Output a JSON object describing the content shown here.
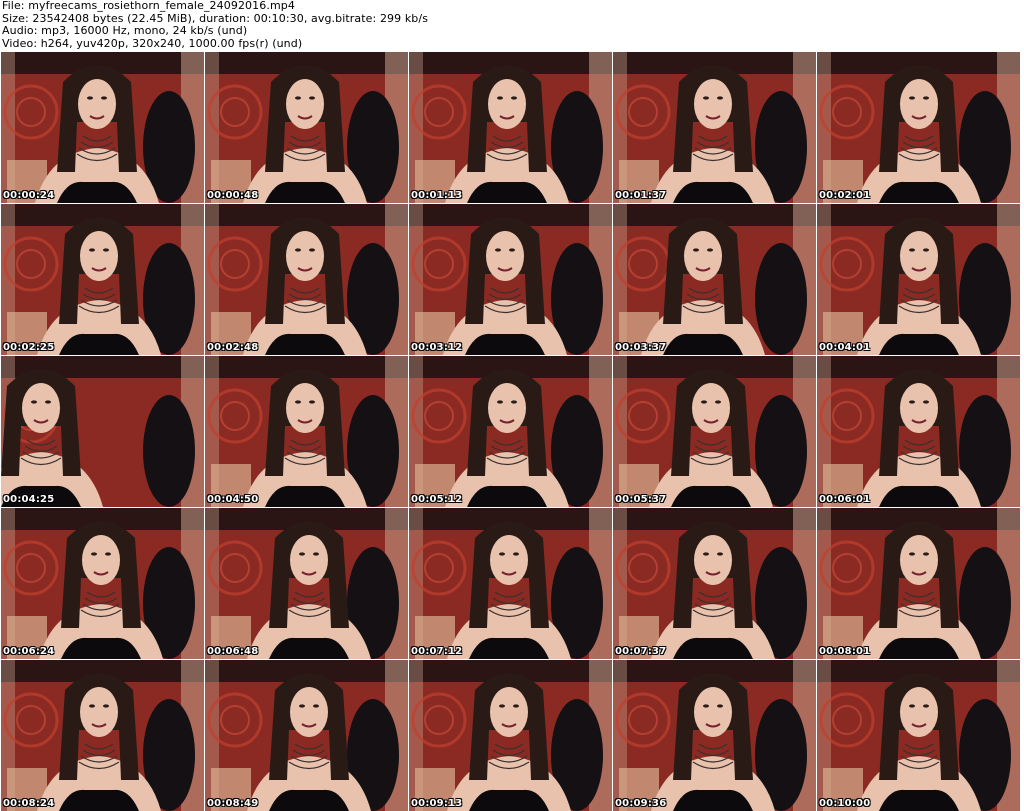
{
  "header": {
    "file": "File: myfreecams_rosiethorn_female_24092016.mp4",
    "size": "Size: 23542408 bytes (22.45 MiB), duration: 00:10:30, avg.bitrate: 299 kb/s",
    "audio": "Audio: mp3, 16000 Hz, mono, 24 kb/s (und)",
    "video": "Video: h264, yuv420p, 320x240, 1000.00 fps(r) (und)"
  },
  "thumbnails": [
    {
      "time": "00:00:24"
    },
    {
      "time": "00:00:48"
    },
    {
      "time": "00:01:13"
    },
    {
      "time": "00:01:37"
    },
    {
      "time": "00:02:01"
    },
    {
      "time": "00:02:25"
    },
    {
      "time": "00:02:48"
    },
    {
      "time": "00:03:12"
    },
    {
      "time": "00:03:37"
    },
    {
      "time": "00:04:01"
    },
    {
      "time": "00:04:25"
    },
    {
      "time": "00:04:50"
    },
    {
      "time": "00:05:12"
    },
    {
      "time": "00:05:37"
    },
    {
      "time": "00:06:01"
    },
    {
      "time": "00:06:24"
    },
    {
      "time": "00:06:48"
    },
    {
      "time": "00:07:12"
    },
    {
      "time": "00:07:37"
    },
    {
      "time": "00:08:01"
    },
    {
      "time": "00:08:24"
    },
    {
      "time": "00:08:49"
    },
    {
      "time": "00:09:13"
    },
    {
      "time": "00:09:36"
    },
    {
      "time": "00:10:00"
    }
  ],
  "colors": {
    "background_wall": "#8a2a22",
    "curtain": "#c8a08a",
    "chair": "#141014",
    "hair": "#2a1a16",
    "skin": "#e8c2ac",
    "top": "#0c0a0c",
    "timestamp_text": "#ffffff"
  }
}
